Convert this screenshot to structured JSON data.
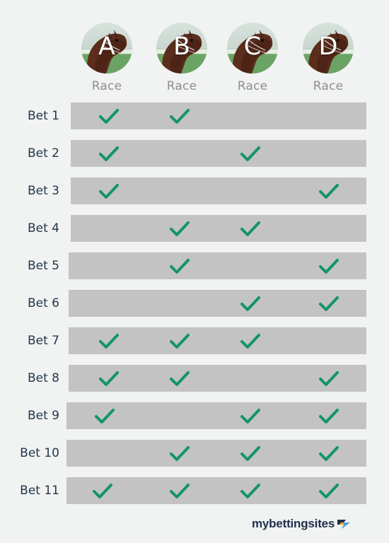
{
  "races": [
    {
      "letter": "A",
      "label": "Race"
    },
    {
      "letter": "B",
      "label": "Race"
    },
    {
      "letter": "C",
      "label": "Race"
    },
    {
      "letter": "D",
      "label": "Race"
    }
  ],
  "bets": [
    {
      "label": "Bet 1",
      "selections": [
        true,
        true,
        false,
        false
      ]
    },
    {
      "label": "Bet 2",
      "selections": [
        true,
        false,
        true,
        false
      ]
    },
    {
      "label": "Bet 3",
      "selections": [
        true,
        false,
        false,
        true
      ]
    },
    {
      "label": "Bet 4",
      "selections": [
        false,
        true,
        true,
        false
      ]
    },
    {
      "label": "Bet 5",
      "selections": [
        false,
        true,
        false,
        true
      ]
    },
    {
      "label": "Bet 6",
      "selections": [
        false,
        false,
        true,
        true
      ]
    },
    {
      "label": "Bet 7",
      "selections": [
        true,
        true,
        true,
        false
      ]
    },
    {
      "label": "Bet 8",
      "selections": [
        true,
        true,
        false,
        true
      ]
    },
    {
      "label": "Bet 9",
      "selections": [
        true,
        false,
        true,
        true
      ]
    },
    {
      "label": "Bet 10",
      "selections": [
        false,
        true,
        true,
        true
      ]
    },
    {
      "label": "Bet 11",
      "selections": [
        true,
        true,
        true,
        true
      ]
    }
  ],
  "brand": {
    "name": "mybettingsites",
    "logo_icon": "arrow-logo-icon"
  },
  "colors": {
    "background": "#f1f2f2",
    "bar": "#c3c3c3",
    "check": "#129565",
    "race_label": "#8e8e8e",
    "bet_label": "#24374a"
  }
}
